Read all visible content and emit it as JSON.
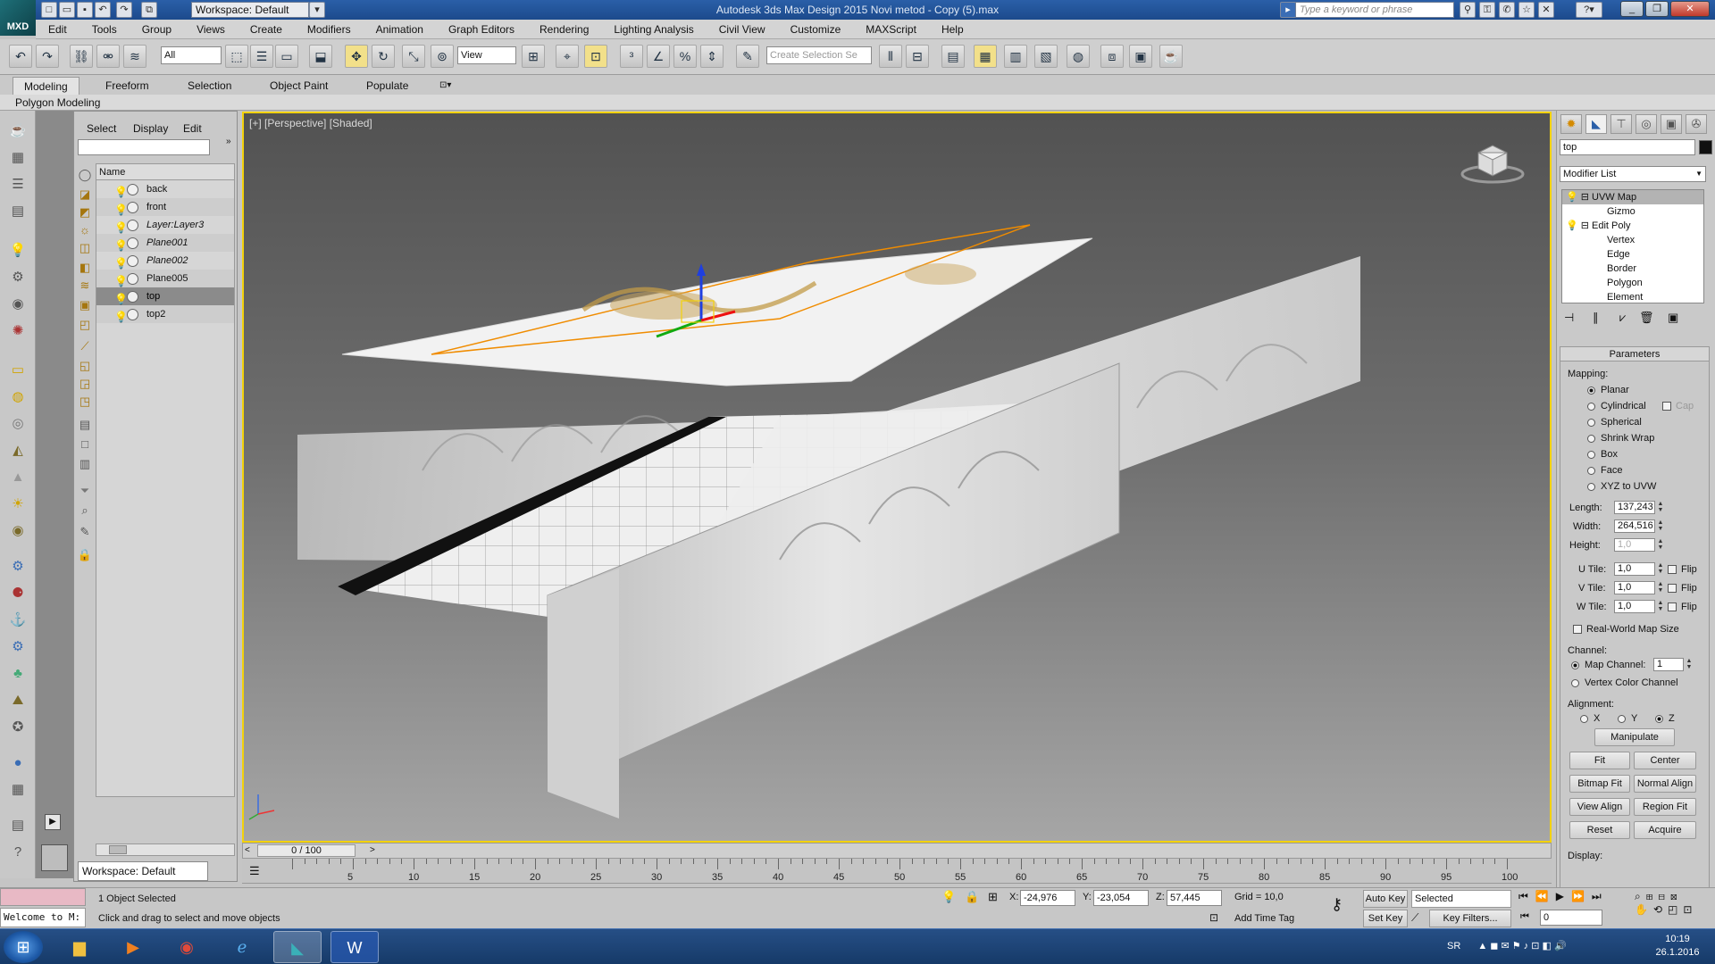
{
  "app": {
    "title": "Autodesk 3ds Max Design 2015    Novi metod - Copy (5).max",
    "logo_label": "MXD",
    "workspace": "Workspace: Default",
    "search_placeholder": "Type a keyword or phrase"
  },
  "menu": [
    "Edit",
    "Tools",
    "Group",
    "Views",
    "Create",
    "Modifiers",
    "Animation",
    "Graph Editors",
    "Rendering",
    "Lighting Analysis",
    "Civil View",
    "Customize",
    "MAXScript",
    "Help"
  ],
  "toolbar": {
    "selection_filter": "All",
    "ref_coord": "View",
    "named_selection_placeholder": "Create Selection Se"
  },
  "ribbon": {
    "tabs": [
      "Modeling",
      "Freeform",
      "Selection",
      "Object Paint",
      "Populate"
    ],
    "active_tab": "Modeling",
    "sub_label": "Polygon Modeling"
  },
  "explorer": {
    "menu": [
      "Select",
      "Display",
      "Edit"
    ],
    "column_header": "Name",
    "rows": [
      {
        "name": "back",
        "italic": false
      },
      {
        "name": "front",
        "italic": false
      },
      {
        "name": "Layer:Layer3",
        "italic": true
      },
      {
        "name": "Plane001",
        "italic": true
      },
      {
        "name": "Plane002",
        "italic": true
      },
      {
        "name": "Plane005",
        "italic": false
      },
      {
        "name": "top",
        "italic": false,
        "selected": true
      },
      {
        "name": "top2",
        "italic": false
      }
    ],
    "workspace": "Workspace: Default"
  },
  "viewport": {
    "label": "[+] [Perspective] [Shaded]",
    "border_color": "#f3d20b"
  },
  "timeline": {
    "slider_label": "0 / 100",
    "ticks": [
      0,
      5,
      10,
      15,
      20,
      25,
      30,
      35,
      40,
      45,
      50,
      55,
      60,
      65,
      70,
      75,
      80,
      85,
      90,
      95,
      100
    ]
  },
  "command_panel": {
    "object_name": "top",
    "modifier_list": "Modifier List",
    "stack": [
      {
        "label": "UVW Map",
        "level": 0,
        "selected": true
      },
      {
        "label": "Gizmo",
        "level": 1
      },
      {
        "label": "Edit Poly",
        "level": 0
      },
      {
        "label": "Vertex",
        "level": 1
      },
      {
        "label": "Edge",
        "level": 1
      },
      {
        "label": "Border",
        "level": 1
      },
      {
        "label": "Polygon",
        "level": 1
      },
      {
        "label": "Element",
        "level": 1
      }
    ],
    "params": {
      "title": "Parameters",
      "mapping_label": "Mapping:",
      "mapping_options": [
        "Planar",
        "Cylindrical",
        "Spherical",
        "Shrink Wrap",
        "Box",
        "Face",
        "XYZ to UVW"
      ],
      "mapping_selected": "Planar",
      "cap_label": "Cap",
      "length_label": "Length:",
      "length": "137,243",
      "width_label": "Width:",
      "width": "264,516",
      "height_label": "Height:",
      "height": "1,0",
      "utile_label": "U Tile:",
      "utile": "1,0",
      "vtile_label": "V Tile:",
      "vtile": "1,0",
      "wtile_label": "W Tile:",
      "wtile": "1,0",
      "flip_label": "Flip",
      "realworld_label": "Real-World Map Size",
      "channel_label": "Channel:",
      "map_channel_label": "Map Channel:",
      "map_channel": "1",
      "vertex_color_label": "Vertex Color Channel",
      "alignment_label": "Alignment:",
      "axes": [
        "X",
        "Y",
        "Z"
      ],
      "axis_selected": "Z",
      "manipulate": "Manipulate",
      "buttons": [
        [
          "Fit",
          "Center"
        ],
        [
          "Bitmap Fit",
          "Normal Align"
        ],
        [
          "View Align",
          "Region Fit"
        ],
        [
          "Reset",
          "Acquire"
        ]
      ],
      "display_label": "Display:"
    }
  },
  "status": {
    "listener": "Welcome to M:",
    "selected": "1 Object Selected",
    "prompt": "Click and drag to select and move objects",
    "x_label": "X:",
    "x": "-24,976",
    "y_label": "Y:",
    "y": "-23,054",
    "z_label": "Z:",
    "z": "57,445",
    "grid": "Grid = 10,0",
    "add_time_tag": "Add Time Tag",
    "auto_key": "Auto Key",
    "set_key": "Set Key",
    "key_mode": "Selected",
    "key_filters": "Key Filters...",
    "frame": "0"
  },
  "taskbar": {
    "lang": "SR",
    "time": "10:19",
    "date": "26.1.2016"
  }
}
